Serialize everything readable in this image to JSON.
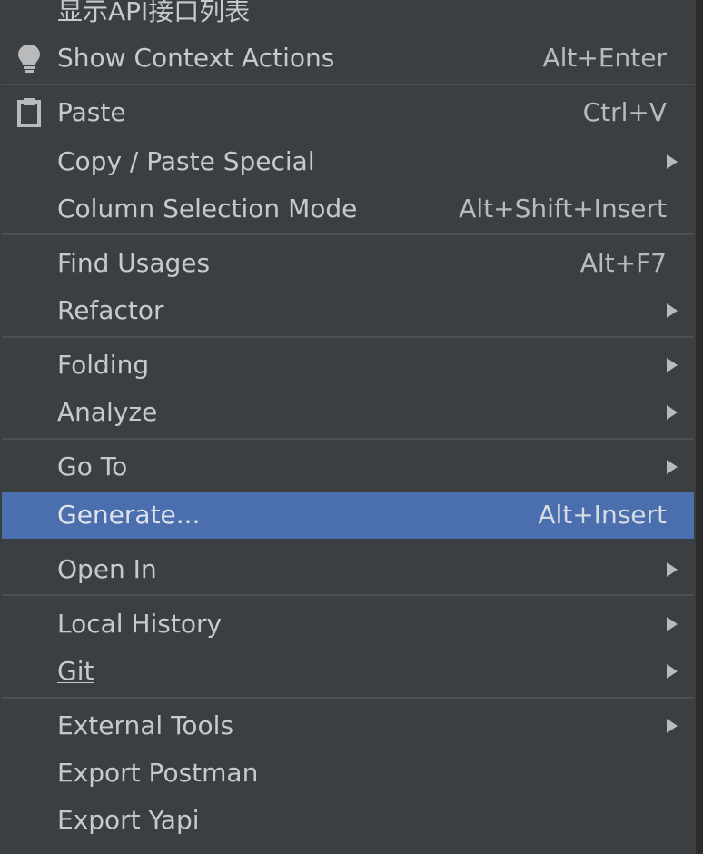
{
  "menu": {
    "items": [
      {
        "label": "显示API接口列表",
        "shortcut": "",
        "submenu": false,
        "icon": ""
      },
      {
        "label": "Show Context Actions",
        "shortcut": "Alt+Enter",
        "submenu": false,
        "icon": "lightbulb-icon"
      },
      {
        "label": "Paste",
        "shortcut": "Ctrl+V",
        "submenu": false,
        "icon": "clipboard-icon"
      },
      {
        "label": "Copy / Paste Special",
        "shortcut": "",
        "submenu": true,
        "icon": ""
      },
      {
        "label": "Column Selection Mode",
        "shortcut": "Alt+Shift+Insert",
        "submenu": false,
        "icon": ""
      },
      {
        "label": "Find Usages",
        "shortcut": "Alt+F7",
        "submenu": false,
        "icon": ""
      },
      {
        "label": "Refactor",
        "shortcut": "",
        "submenu": true,
        "icon": ""
      },
      {
        "label": "Folding",
        "shortcut": "",
        "submenu": true,
        "icon": ""
      },
      {
        "label": "Analyze",
        "shortcut": "",
        "submenu": true,
        "icon": ""
      },
      {
        "label": "Go To",
        "shortcut": "",
        "submenu": true,
        "icon": ""
      },
      {
        "label": "Generate...",
        "shortcut": "Alt+Insert",
        "submenu": false,
        "icon": "",
        "highlighted": true
      },
      {
        "label": "Open In",
        "shortcut": "",
        "submenu": true,
        "icon": ""
      },
      {
        "label": "Local History",
        "shortcut": "",
        "submenu": true,
        "icon": ""
      },
      {
        "label": "Git",
        "shortcut": "",
        "submenu": true,
        "icon": ""
      },
      {
        "label": "External Tools",
        "shortcut": "",
        "submenu": true,
        "icon": ""
      },
      {
        "label": "Export Postman",
        "shortcut": "",
        "submenu": false,
        "icon": ""
      },
      {
        "label": "Export Yapi",
        "shortcut": "",
        "submenu": false,
        "icon": ""
      }
    ]
  },
  "colors": {
    "background": "#3c3f41",
    "highlight": "#4b6eaf",
    "text": "#c8c9ca",
    "separator": "#4d5052"
  }
}
